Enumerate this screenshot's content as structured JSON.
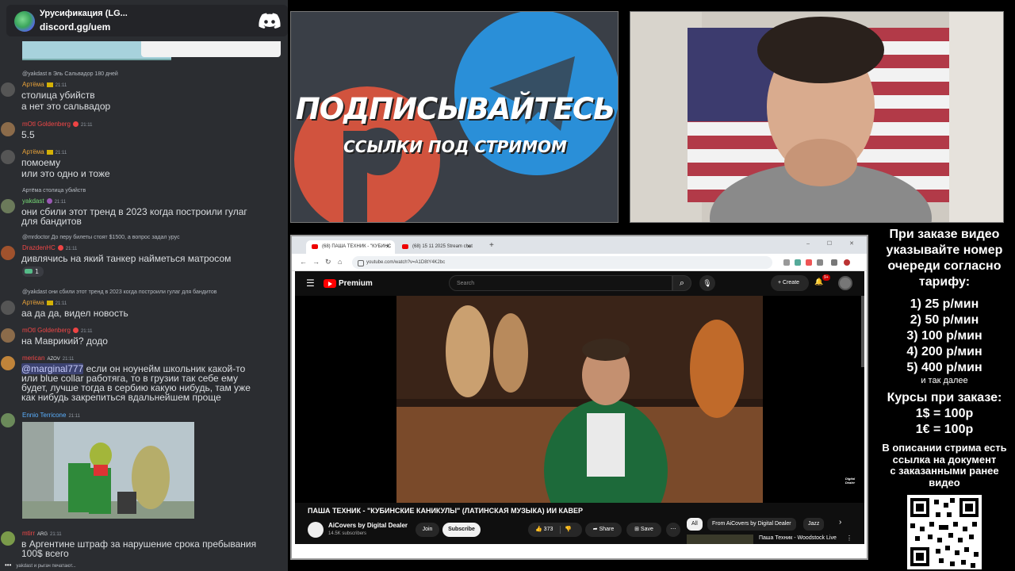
{
  "discord": {
    "server_name": "Урусификация (LG...",
    "invite_link": "discord.gg/uem",
    "typing_text": "yakdast и рыгач печатают..."
  },
  "chat": {
    "messages": [
      {
        "reply": "@yakdast в Эль Сальвадор 180 дней",
        "user": "Артёма",
        "time": "21:11",
        "color": "#e8a23a",
        "lines": [
          "столица убийств",
          "а нет это сальвадор"
        ]
      },
      {
        "user": "mOtl Goldenberg",
        "time": "21:11",
        "color": "#f04747",
        "lines": [
          "5.5"
        ]
      },
      {
        "user": "Артёма",
        "time": "21:11",
        "color": "#e8a23a",
        "lines": [
          "помоему",
          "или это одно и тоже"
        ]
      },
      {
        "reply": "Артёма столица убийств",
        "user": "yakdast",
        "time": "21:11",
        "color": "#77d977",
        "lines": [
          "они сбили этот тренд в 2023 когда построили гулаг",
          "для бандитов"
        ]
      },
      {
        "reply": "@mrdoctor До перу билеты стоят $1500, а вопрос задал урус",
        "user": "DrazdenHC",
        "time": "21:11",
        "color": "#f04747",
        "lines": [
          "дивлячись на який танкер найметься матросом"
        ],
        "reaction_count": "1"
      },
      {
        "reply": "@yakdast они сбили этот тренд в 2023 когда построили гулаг для бандитов",
        "user": "Артёма",
        "time": "21:11",
        "color": "#e8a23a",
        "lines": [
          "аа да да, видел новость"
        ]
      },
      {
        "user": "mOtl Goldenberg",
        "time": "21:11",
        "color": "#f04747",
        "lines": [
          "на Маврикий? додо"
        ]
      },
      {
        "user": "merican",
        "tag": "AZOV",
        "time": "21:11",
        "color": "#f04747",
        "mention": "@marginal777",
        "lines": [
          " если он ноунейм школьник какой-то",
          "или blue collar работяга, то в грузии так себе ему",
          "будет, лучше тогда в сербию какую нибудь, там уже",
          "как нибудь закрепиться вдальнейшем проще"
        ]
      },
      {
        "user": "Ennio Terricone",
        "time": "21:11",
        "color": "#5ab0ff",
        "lines": []
      },
      {
        "user": "mtirr",
        "tag": "ARG",
        "time": "21:11",
        "color": "#f04747",
        "lines": [
          "в Аргентине штраф за нарушение срока пребывания",
          "100$ всего"
        ]
      }
    ]
  },
  "promo": {
    "line1": "ПОДПИСЫВАЙТЕСЬ",
    "line2": "ССЫЛКИ ПОД СТРИМОМ"
  },
  "browser": {
    "tabs": [
      {
        "label": "(68) ПАША ТЕХНИК - \"КУБИНС"
      },
      {
        "label": "(68) 15 11 2025 Stream chat"
      }
    ],
    "url": "youtube.com/watch?v=A1D8tY4K2bc"
  },
  "youtube": {
    "brand": "Premium",
    "search_placeholder": "Search",
    "create_label": "+ Create",
    "notif_count": "9+",
    "video_title": "ПАША ТЕХНИК - \"КУБИНСКИЕ КАНИКУЛЫ\" (ЛАТИНСКАЯ МУЗЫКА) ИИ КАВЕР",
    "channel_name": "AiCovers by Digital Dealer",
    "subscribers": "14.5K subscribers",
    "join_label": "Join",
    "subscribe_label": "Subscribe",
    "like_count": "373",
    "share_label": "Share",
    "save_label": "Save",
    "chips": [
      "All",
      "From AiCovers by Digital Dealer",
      "Jazz"
    ],
    "rec_title": "Паша Техник - Woodstock Live",
    "watermark": "Digital Dealer"
  },
  "pricing": {
    "header": [
      "При заказе видео",
      "указывайте номер",
      "очереди согласно",
      "тарифу:"
    ],
    "tiers": [
      "1) 25 р/мин",
      "2) 50 р/мин",
      "3) 100 р/мин",
      "4) 200 р/мин",
      "5) 400 р/мин"
    ],
    "etc": "и так далее",
    "courses_header": "Курсы при заказе:",
    "rates": [
      "1$ = 100р",
      "1€ = 100р"
    ],
    "footer": [
      "В описании стрима есть",
      "ссылка на документ",
      "с заказанными ранее",
      "видео"
    ]
  }
}
